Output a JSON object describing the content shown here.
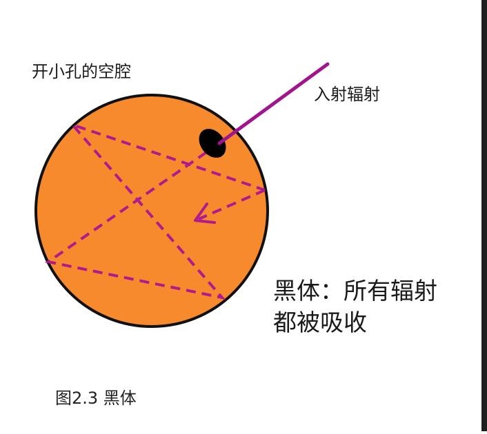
{
  "diagram": {
    "cavity_label": "开小孔的空腔",
    "incoming_label": "入射辐射",
    "blackbody_label": "黑体：所有辐射都被吸收",
    "caption": "图2.3 黑体"
  },
  "colors": {
    "cavity_fill": "#f68a2c",
    "cavity_stroke": "#111111",
    "ray_solid": "#a0148e",
    "ray_dashed": "#b01a8c",
    "hole": "#000000",
    "edge_bar": "#1f1f1f"
  }
}
